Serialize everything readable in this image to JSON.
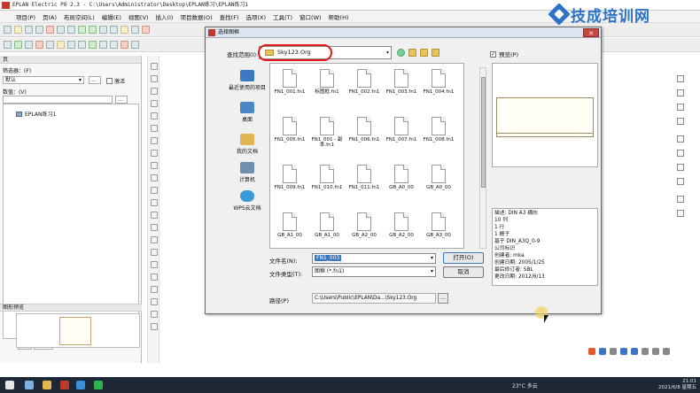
{
  "app": {
    "title": "EPLAN Electric P8 2.3 - C:\\Users\\Administrator\\Desktop\\EPLAN练习\\EPLAN练习1",
    "menu": [
      "项目(P)",
      "页(A)",
      "布局空间(L)",
      "编辑(E)",
      "视图(V)",
      "插入(I)",
      "项目数据(O)",
      "查找(F)",
      "选项(X)",
      "工具(T)",
      "窗口(W)",
      "帮助(H)"
    ]
  },
  "watermark": {
    "text": "技成培训网"
  },
  "left_panel": {
    "title": "页",
    "filter_label": "筛选器：(F)",
    "filter_value": "默认",
    "activate_label": "激活",
    "value_label": "数值：(V)",
    "tree_item": "EPLAN练习1",
    "tabs": [
      "树",
      "列表"
    ],
    "preview_title": "图形预览"
  },
  "dialog": {
    "title": "选择图框",
    "lookin_label": "查找范围(I):",
    "lookin_value": "Sky123.Org",
    "preview_label": "预览(P)",
    "preview_checked": true,
    "places": [
      {
        "label": "最近使用的项目",
        "color": "#3d78c2"
      },
      {
        "label": "桌面",
        "color": "#4a86c8"
      },
      {
        "label": "我的文档",
        "color": "#e0b650"
      },
      {
        "label": "计算机",
        "color": "#6f8fae"
      },
      {
        "label": "WPS云文档",
        "color": "#3a9ad9"
      }
    ],
    "files": [
      "FN1_001.fn1",
      "标图框.fn1",
      "FN1_002.fn1",
      "FN1_003.fn1",
      "FN1_004.fn1",
      "FN1_005.fn1",
      "FN1_001 - 副本.fn1",
      "FN1_006.fn1",
      "FN1_007.fn1",
      "FN1_008.fn1",
      "FN1_009.fn1",
      "FN1_010.fn1",
      "FN1_011.fn1",
      "GB_A0_00",
      "GB_A0_00",
      "GB_A1_00",
      "GB_A1_00",
      "GB_A2_00",
      "GB_A2_00",
      "GB_A3_00"
    ],
    "properties": [
      "描述: DIN A3 横向",
      "10 列",
      "1 行",
      "1 栅子",
      "基于 DIN_A3Q_0-9",
      "公司标识",
      "创建者: mka",
      "创建日期: 2005/1/25",
      "最后修订者: SBL",
      "更改日期: 2012/6/13"
    ],
    "filename_label": "文件名(N):",
    "filename_value": "FN1_003",
    "filetype_label": "文件类型(T):",
    "filetype_value": "图框 (*.fn1)",
    "open_button": "打开(O)",
    "cancel_button": "取消",
    "path_label": "路径(P)",
    "path_value": "C:\\Users\\Public\\EPLAN\\Da...\\Sky123.Org"
  },
  "taskbar": {
    "weather": "23°C 多云",
    "time": "21:01",
    "date": "2021/6/8 星期五"
  }
}
